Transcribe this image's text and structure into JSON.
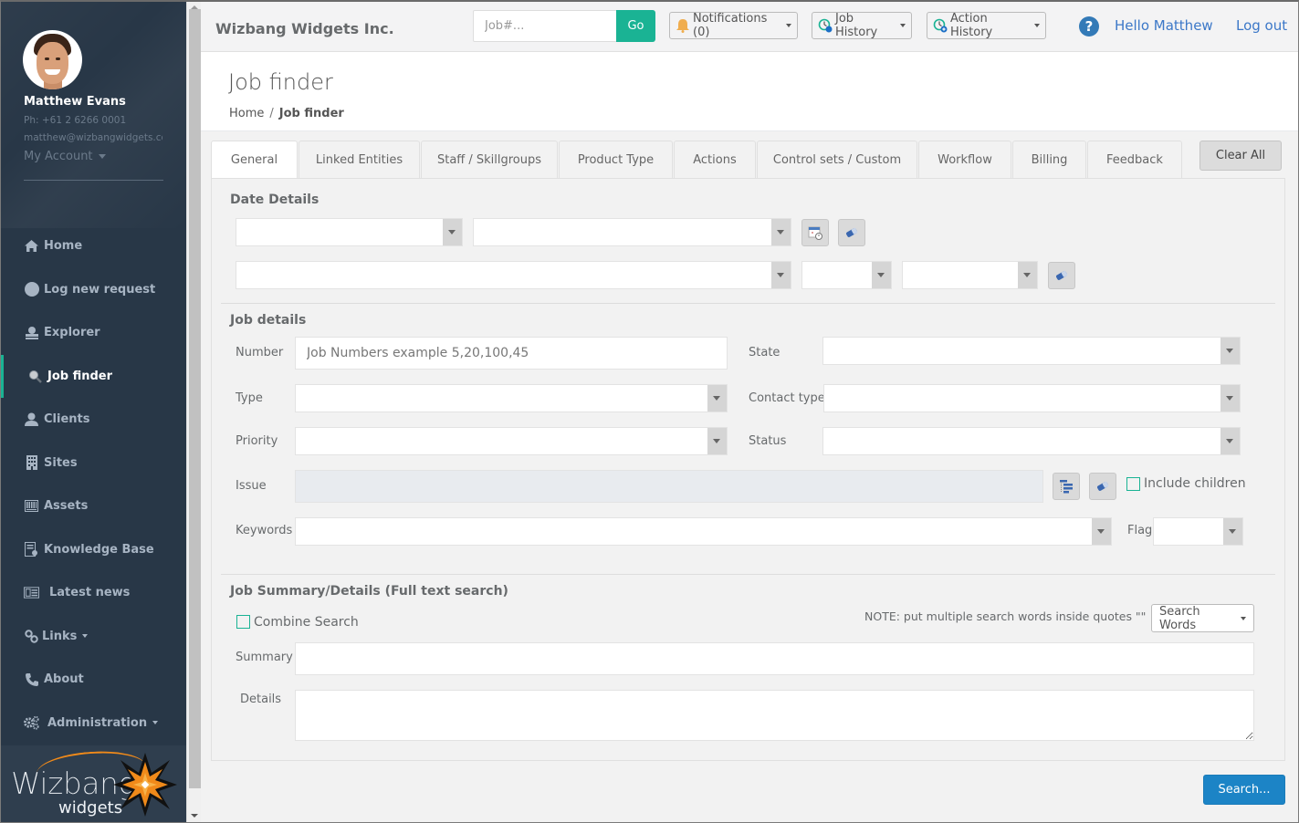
{
  "user": {
    "name": "Matthew Evans",
    "phone": "Ph: +61 2 6266 0001",
    "email": "matthew@wizbangwidgets.co",
    "my_account_label": "My Account"
  },
  "sidebar": {
    "items": [
      {
        "label": "Home",
        "icon": "home-icon",
        "active": false
      },
      {
        "label": "Log new request",
        "icon": "circle-icon",
        "active": false
      },
      {
        "label": "Explorer",
        "icon": "explorer-icon",
        "active": false
      },
      {
        "label": "Job finder",
        "icon": "search-icon",
        "active": true
      },
      {
        "label": "Clients",
        "icon": "user-icon",
        "active": false
      },
      {
        "label": "Sites",
        "icon": "building-icon",
        "active": false
      },
      {
        "label": "Assets",
        "icon": "assets-icon",
        "active": false
      },
      {
        "label": "Knowledge Base",
        "icon": "knowledge-base-icon",
        "active": false
      },
      {
        "label": "Latest news",
        "icon": "newspaper-icon",
        "active": false
      },
      {
        "label": "Links",
        "icon": "link-icon",
        "active": false,
        "has_dropdown": true
      },
      {
        "label": "About",
        "icon": "phone-icon",
        "active": false
      },
      {
        "label": "Administration",
        "icon": "gears-icon",
        "active": false,
        "has_dropdown": true
      }
    ],
    "logo": {
      "line1": "Wizbang",
      "line2": "widgets"
    }
  },
  "topbar": {
    "company": "Wizbang Widgets Inc.",
    "job_search_placeholder": "Job#...",
    "go_label": "Go",
    "notifications_label": "Notifications (0)",
    "job_history_label": "Job History",
    "action_history_label": "Action History",
    "help_glyph": "?",
    "hello_label": "Hello Matthew",
    "logout_label": "Log out"
  },
  "page": {
    "title": "Job finder",
    "breadcrumb": {
      "home": "Home",
      "separator": "/",
      "current": "Job finder"
    }
  },
  "tabs": [
    {
      "label": "General",
      "active": true
    },
    {
      "label": "Linked Entities",
      "active": false
    },
    {
      "label": "Staff / Skillgroups",
      "active": false
    },
    {
      "label": "Product Type",
      "active": false
    },
    {
      "label": "Actions",
      "active": false
    },
    {
      "label": "Control sets / Custom",
      "active": false
    },
    {
      "label": "Workflow",
      "active": false
    },
    {
      "label": "Billing",
      "active": false
    },
    {
      "label": "Feedback",
      "active": false
    }
  ],
  "clear_all_label": "Clear All",
  "date_details": {
    "title": "Date Details",
    "selects": [
      "",
      "",
      "",
      "",
      ""
    ]
  },
  "job_details": {
    "title": "Job details",
    "number_label": "Number",
    "number_placeholder": "Job Numbers example 5,20,100,45",
    "number_value": "",
    "state_label": "State",
    "state_value": "",
    "type_label": "Type",
    "type_value": "",
    "contact_type_label": "Contact type",
    "contact_type_value": "",
    "priority_label": "Priority",
    "priority_value": "",
    "status_label": "Status",
    "status_value": "",
    "issue_label": "Issue",
    "issue_value": "",
    "include_children_label": "Include children",
    "include_children_checked": false,
    "keywords_label": "Keywords",
    "keywords_value": "",
    "flag_label": "Flag",
    "flag_value": ""
  },
  "full_text": {
    "title": "Job Summary/Details (Full text search)",
    "combine_label": "Combine Search",
    "combine_checked": false,
    "note": "NOTE: put multiple search words inside quotes \"\"",
    "search_words_label": "Search Words",
    "summary_label": "Summary",
    "summary_value": "",
    "details_label": "Details",
    "details_value": ""
  },
  "search_button_label": "Search...",
  "colors": {
    "sidebar_bg": "#283747",
    "accent_green": "#1ab394",
    "primary_blue": "#1c84c6",
    "link_blue": "#3c78c8"
  }
}
